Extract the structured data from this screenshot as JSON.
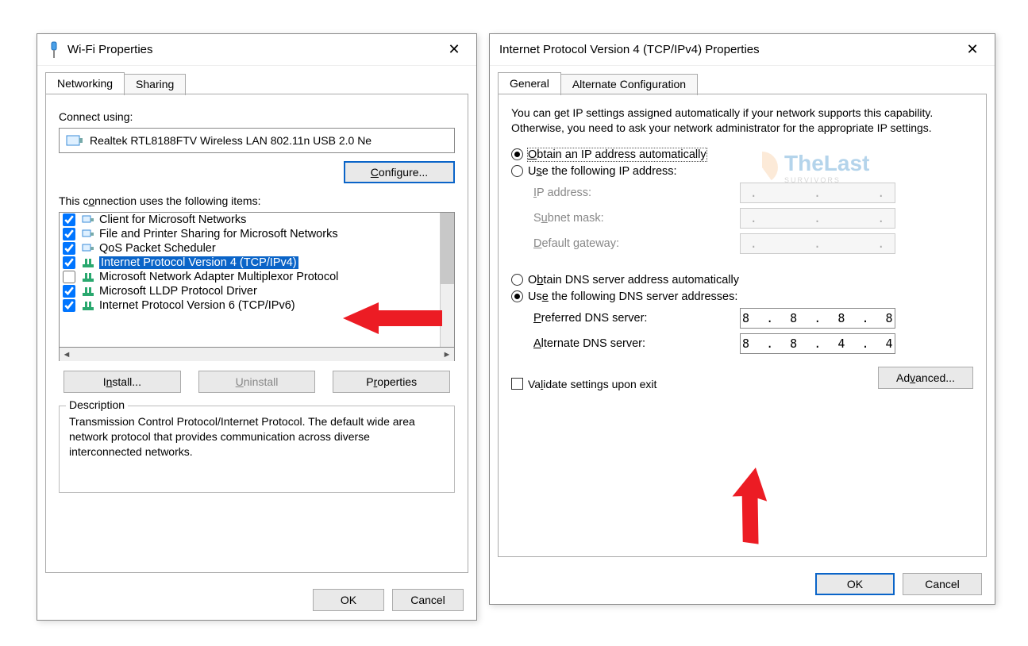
{
  "wifi": {
    "title": "Wi-Fi Properties",
    "tabs": {
      "networking": "Networking",
      "sharing": "Sharing"
    },
    "connect_using_label": "Connect using:",
    "adapter_name": "Realtek RTL8188FTV Wireless LAN 802.11n USB 2.0 Ne",
    "configure_btn": "Configure...",
    "items_label": "This connection uses the following items:",
    "items": [
      {
        "checked": true,
        "text": "Client for Microsoft Networks",
        "icon": "svc"
      },
      {
        "checked": true,
        "text": "File and Printer Sharing for Microsoft Networks",
        "icon": "svc"
      },
      {
        "checked": true,
        "text": "QoS Packet Scheduler",
        "icon": "svc"
      },
      {
        "checked": true,
        "text": "Internet Protocol Version 4 (TCP/IPv4)",
        "icon": "proto",
        "selected": true
      },
      {
        "checked": false,
        "text": "Microsoft Network Adapter Multiplexor Protocol",
        "icon": "proto"
      },
      {
        "checked": true,
        "text": "Microsoft LLDP Protocol Driver",
        "icon": "proto"
      },
      {
        "checked": true,
        "text": "Internet Protocol Version 6 (TCP/IPv6)",
        "icon": "proto"
      }
    ],
    "install_btn": "Install...",
    "uninstall_btn": "Uninstall",
    "properties_btn": "Properties",
    "desc_legend": "Description",
    "desc_text": "Transmission Control Protocol/Internet Protocol. The default wide area network protocol that provides communication across diverse interconnected networks.",
    "ok_btn": "OK",
    "cancel_btn": "Cancel"
  },
  "ipv4": {
    "title": "Internet Protocol Version 4 (TCP/IPv4) Properties",
    "tabs": {
      "general": "General",
      "alt": "Alternate Configuration"
    },
    "intro": "You can get IP settings assigned automatically if your network supports this capability. Otherwise, you need to ask your network administrator for the appropriate IP settings.",
    "ip_auto_label": "Obtain an IP address automatically",
    "ip_manual_label": "Use the following IP address:",
    "ip_address_label": "IP address:",
    "subnet_label": "Subnet mask:",
    "gateway_label": "Default gateway:",
    "ip_address_value": ".       .       .",
    "subnet_value": ".       .       .",
    "gateway_value": ".       .       .",
    "dns_auto_label": "Obtain DNS server address automatically",
    "dns_manual_label": "Use the following DNS server addresses:",
    "pref_dns_label": "Preferred DNS server:",
    "pref_dns_value": "8  .  8  .  8  .  8",
    "alt_dns_label": "Alternate DNS server:",
    "alt_dns_value": "8  .  8  .  4  .  4",
    "validate_label": "Validate settings upon exit",
    "advanced_btn": "Advanced...",
    "ok_btn": "OK",
    "cancel_btn": "Cancel"
  },
  "watermark": {
    "brand": "TheLast",
    "sub": "SURVIVORS"
  }
}
